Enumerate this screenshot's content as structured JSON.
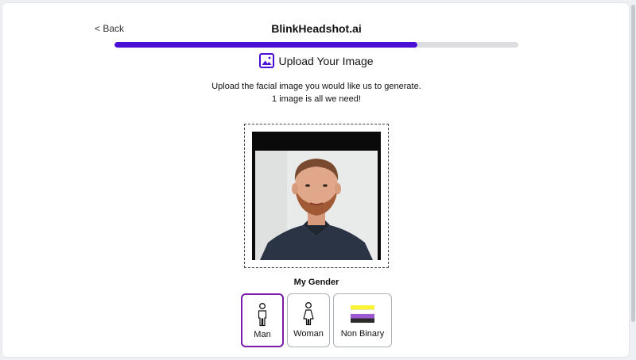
{
  "header": {
    "back_label": "< Back",
    "brand": "BlinkHeadshot.ai"
  },
  "progress": {
    "fraction": 0.75,
    "color": "#4b10d6"
  },
  "step": {
    "icon": "image-icon",
    "title": "Upload Your Image"
  },
  "description": {
    "line1": "Upload the facial image you would like us to generate.",
    "line2": "1 image is all we need!"
  },
  "upload": {
    "photo": "headshot-photo"
  },
  "gender": {
    "label": "My Gender",
    "selected": "Man",
    "options": [
      {
        "label": "Man",
        "icon": "man-icon"
      },
      {
        "label": "Woman",
        "icon": "woman-icon"
      },
      {
        "label": "Non Binary",
        "icon": "nonbinary-flag-icon"
      }
    ]
  },
  "colors": {
    "accent": "#4b10d6",
    "selected_border": "#7a1aa8",
    "nonbinary_flag": [
      "#fcf434",
      "#ffffff",
      "#9c59d1",
      "#2c2c2c"
    ]
  }
}
